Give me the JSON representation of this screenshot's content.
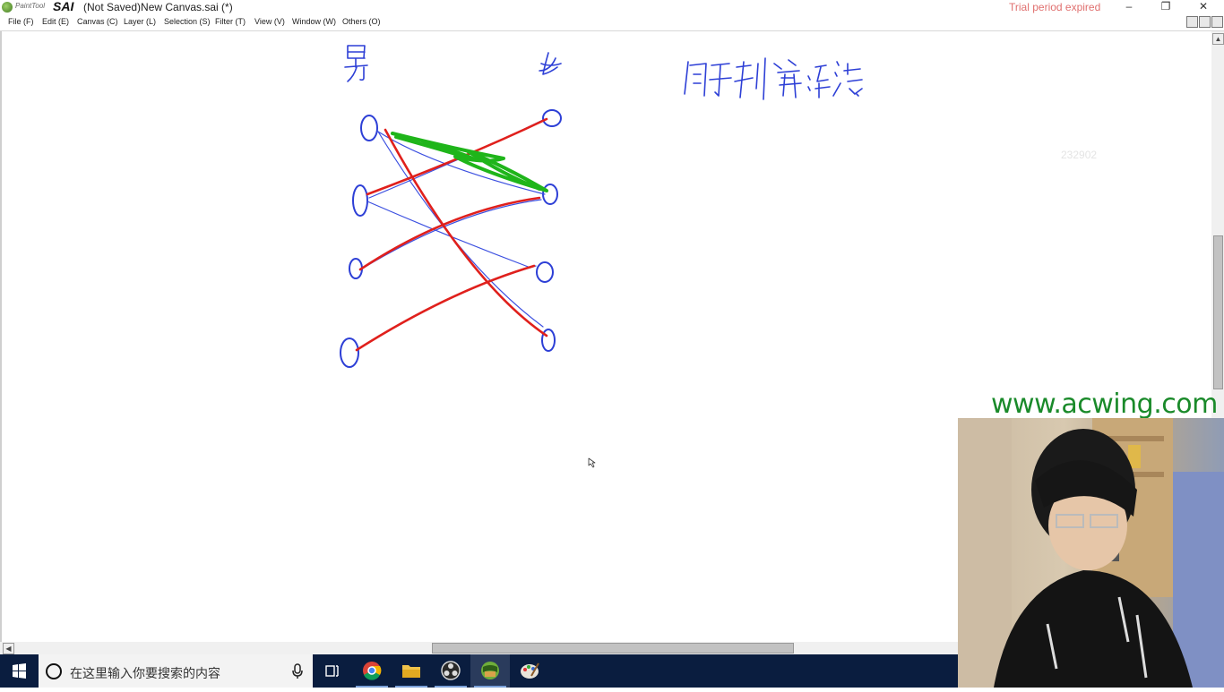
{
  "app": {
    "logo_text": "PaintTool",
    "logo_brand": "SAI",
    "window_title": "(Not Saved)New Canvas.sai (*)",
    "trial_notice": "Trial period expired",
    "window_controls": {
      "minimize": "–",
      "maximize": "❐",
      "close": "✕"
    }
  },
  "menu": {
    "items": [
      "File (F)",
      "Edit (E)",
      "Canvas (C)",
      "Layer (L)",
      "Selection (S)",
      "Filter (T)",
      "View (V)",
      "Window (W)",
      "Others (O)"
    ]
  },
  "canvas": {
    "faint_number": "232902",
    "drawing_description_labels": {
      "left_column": "男",
      "right_column": "女",
      "title": "匈牙利算法"
    },
    "colors": {
      "ink_blue": "#2d3fd6",
      "ink_red": "#e0201c",
      "ink_green": "#1fb51a"
    }
  },
  "watermark": {
    "text": "www.acwing.com",
    "color": "#1a8a2a"
  },
  "taskbar": {
    "search_placeholder": "在这里输入你要搜索的内容",
    "icons": [
      "windows-start-icon",
      "task-view-icon",
      "chrome-icon",
      "file-explorer-icon",
      "obs-icon",
      "paint-tool-sai-icon",
      "painter-palette-icon"
    ]
  }
}
